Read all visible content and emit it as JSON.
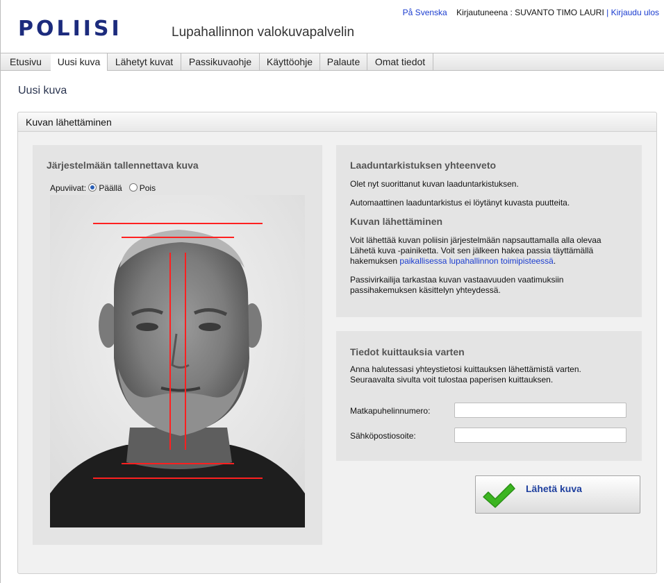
{
  "header": {
    "logo": "POLIISI",
    "app_title": "Lupahallinnon valokuvapalvelin",
    "lang_link": "På Svenska",
    "logged_in_text": "Kirjautuneena : SUVANTO TIMO LAURI",
    "separator": "|",
    "logout_link": "Kirjaudu ulos"
  },
  "nav": {
    "tabs": [
      {
        "label": "Etusivu"
      },
      {
        "label": "Uusi kuva",
        "active": true
      },
      {
        "label": "Lähetyt kuvat"
      },
      {
        "label": "Passikuvaohje"
      },
      {
        "label": "Käyttöohje"
      },
      {
        "label": "Palaute"
      },
      {
        "label": "Omat tiedot"
      }
    ]
  },
  "page": {
    "title": "Uusi kuva",
    "panel_title": "Kuvan lähettäminen"
  },
  "photo_section": {
    "heading": "Järjestelmään tallennettava kuva",
    "guides_label": "Apuviivat:",
    "option_on": "Päällä",
    "option_off": "Pois",
    "selected": "Päällä",
    "guide_color": "#ff2020"
  },
  "quality_section": {
    "heading": "Laaduntarkistuksen yhteenveto",
    "line1": "Olet nyt suorittanut kuvan laaduntarkistuksen.",
    "line2": "Automaattinen laaduntarkistus ei löytänyt kuvasta puutteita.",
    "send_heading": "Kuvan lähettäminen",
    "send_p1": "Voit lähettää kuvan poliisin järjestelmään napsauttamalla alla olevaa",
    "send_p2": "Lähetä kuva -painiketta. Voit sen jälkeen hakea passia täyttämällä",
    "send_p3_prefix": "hakemuksen",
    "send_p3_link": "paikallisessa lupahallinnon toimipisteessä",
    "send_p3_suffix": ".",
    "send_p4": "Passivirkailija tarkastaa kuvan vastaavuuden vaatimuksiin",
    "send_p5": "passihakemuksen käsittelyn yhteydessä."
  },
  "receipt_section": {
    "heading": "Tiedot kuittauksia varten",
    "desc1": "Anna halutessasi yhteystietosi kuittauksen lähettämistä varten.",
    "desc2": "Seuraavalta sivulta voit tulostaa paperisen kuittauksen.",
    "phone_label": "Matkapuhelinnumero:",
    "phone_value": "",
    "email_label": "Sähköpostiosoite:",
    "email_value": ""
  },
  "send_button": {
    "label": "Lähetä kuva",
    "icon": "checkmark-icon",
    "icon_color": "#3cb521"
  }
}
